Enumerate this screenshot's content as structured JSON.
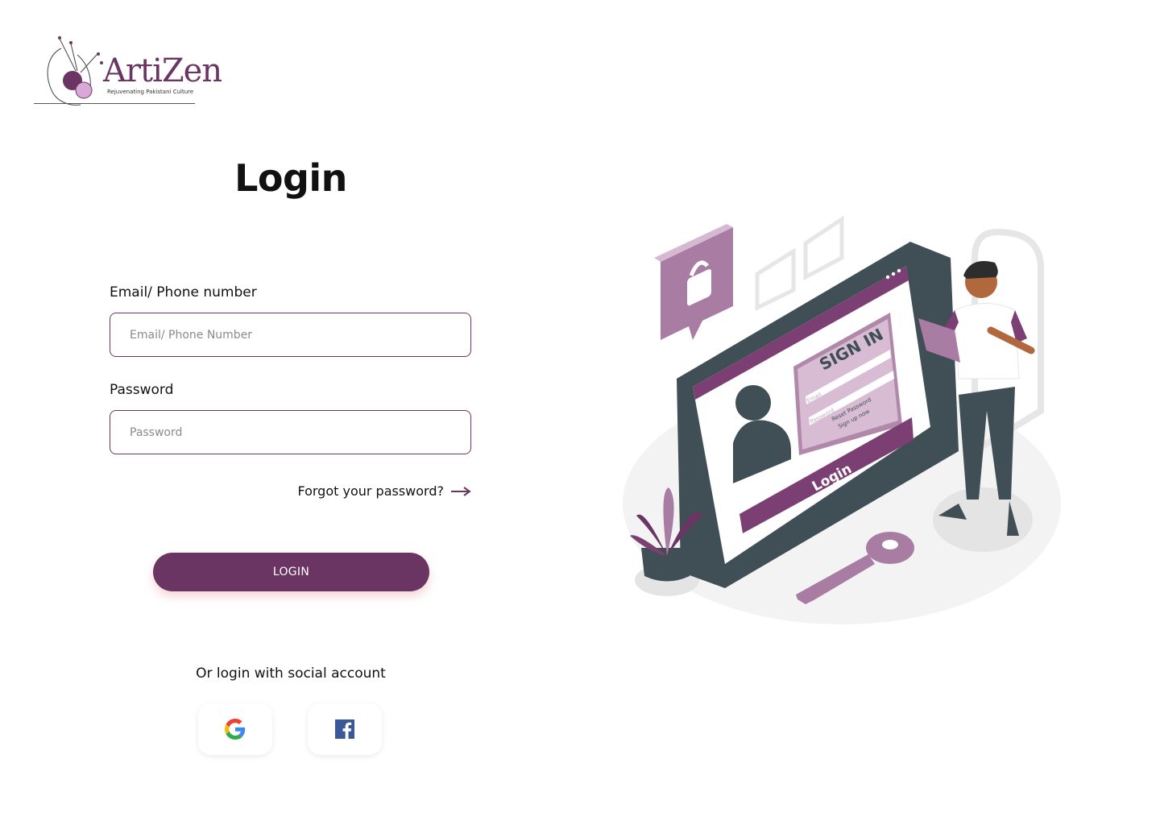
{
  "brand": {
    "name": "ArtiZen",
    "tagline": "Rejuvenating Pakistani Culture",
    "color": "#6b3563"
  },
  "page": {
    "title": "Login"
  },
  "form": {
    "email_label": "Email/ Phone number",
    "email_placeholder": "Email/ Phone Number",
    "email_value": "",
    "password_label": "Password",
    "password_placeholder": "Password",
    "password_value": "",
    "forgot_label": "Forgot your password?",
    "login_label": "LOGIN"
  },
  "social": {
    "heading": "Or login with social account",
    "providers": [
      {
        "name": "google",
        "icon": "google-icon"
      },
      {
        "name": "facebook",
        "icon": "facebook-icon"
      }
    ]
  },
  "illustration": {
    "sign_in": "SIGN IN",
    "email": "Email",
    "password": "Password",
    "reset_password": "Reset Password",
    "sign_up_now": "Sign up now",
    "login_button": "Login"
  }
}
